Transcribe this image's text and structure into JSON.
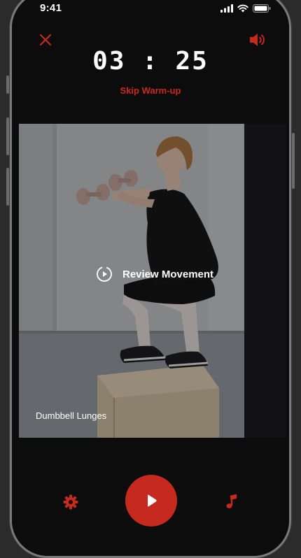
{
  "status_bar": {
    "time": "9:41"
  },
  "workout": {
    "timer": "03 : 25",
    "skip_label": "Skip Warm-up",
    "review_label": "Review Movement",
    "exercise_name": "Dumbbell Lunges"
  },
  "icons": {
    "close": "close-icon",
    "sound": "speaker-icon",
    "review": "play-circle-icon",
    "settings": "gear-icon",
    "play": "play-icon",
    "music": "music-note-icon"
  },
  "colors": {
    "accent": "#c62a1e",
    "background": "#0c0c0c",
    "text": "#ffffff"
  }
}
